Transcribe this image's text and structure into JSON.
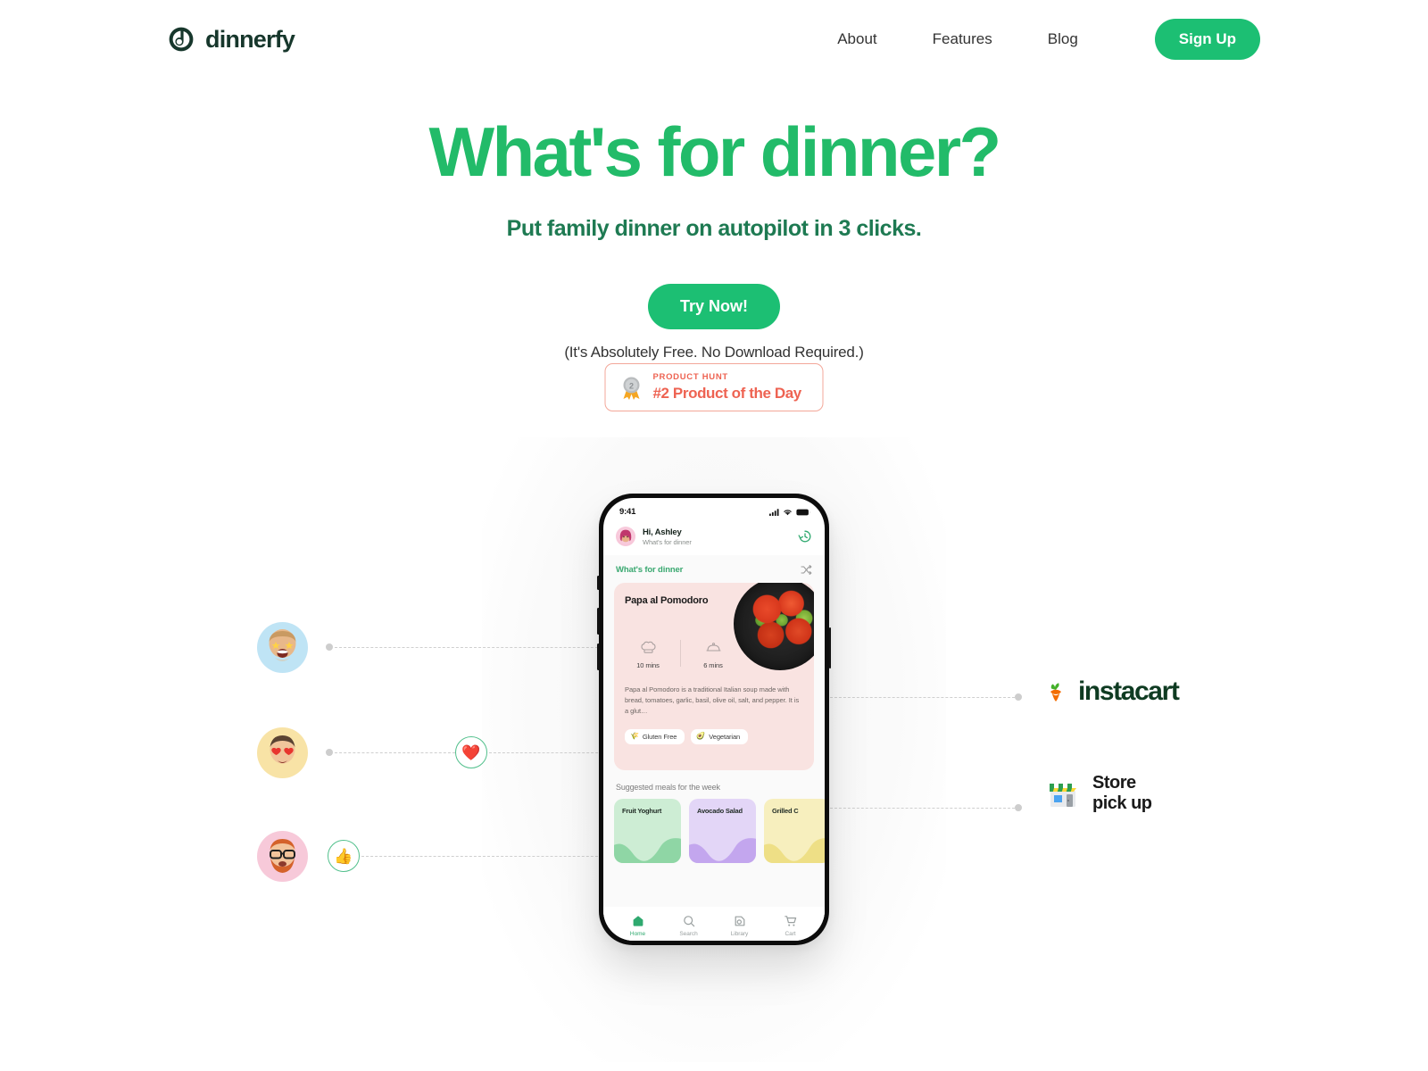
{
  "brand": {
    "name": "dinnerfy",
    "logo_icon": "dinnerfy-logo-icon",
    "accent": "#1cbf73",
    "dark": "#17372c"
  },
  "nav": {
    "links": [
      {
        "label": "About"
      },
      {
        "label": "Features"
      },
      {
        "label": "Blog"
      }
    ],
    "signup_label": "Sign Up"
  },
  "hero": {
    "headline": "What's for dinner?",
    "subhead": "Put family dinner on autopilot in 3 clicks.",
    "cta_label": "Try Now!",
    "disclaimer": "(It's Absolutely Free. No Download Required.)",
    "headline_color": "#22bb69",
    "subhead_color": "#1e7a52"
  },
  "product_hunt": {
    "kicker": "PRODUCT HUNT",
    "title": "#2 Product of the Day",
    "medal_icon": "silver-medal-icon",
    "rank": "2",
    "color": "#ee6352",
    "border_color": "#f3a799"
  },
  "phone": {
    "status": {
      "time": "9:41",
      "cellular_icon": "cellular-bars-icon",
      "wifi_icon": "wifi-icon",
      "battery_icon": "battery-icon"
    },
    "topbar": {
      "avatar_icon": "user-avatar-icon",
      "greeting": "Hi, Ashley",
      "subgreeting": "What's for dinner",
      "history_icon": "history-clock-icon"
    },
    "section": {
      "title": "What's for dinner",
      "shuffle_icon": "shuffle-icon"
    },
    "recipe": {
      "title": "Papa al Pomodoro",
      "photo_icon": "tomato-soup-photo",
      "meta": [
        {
          "icon": "chef-hat-icon",
          "label": "10 mins"
        },
        {
          "icon": "food-cloche-icon",
          "label": "6 mins"
        }
      ],
      "description": "Papa al Pomodoro is a traditional Italian soup made with bread, tomatoes, garlic, basil, olive oil, salt, and pepper. It is a glut…",
      "tags": [
        {
          "emoji": "🌾",
          "label": "Gluten Free"
        },
        {
          "emoji": "🥑",
          "label": "Vegetarian"
        }
      ]
    },
    "suggested": {
      "title": "Suggested meals for the week",
      "meals": [
        {
          "label": "Fruit Yoghurt",
          "bg": "#cdedd4",
          "wave": "#8fd6a5"
        },
        {
          "label": "Avocado Salad",
          "bg": "#e3d6f7",
          "wave": "#c3a6ee"
        },
        {
          "label": "Grilled C",
          "bg": "#f7efbe",
          "wave": "#eedf86"
        }
      ]
    },
    "tabs": [
      {
        "label": "Home",
        "icon": "home-icon",
        "active": true
      },
      {
        "label": "Search",
        "icon": "search-icon",
        "active": false
      },
      {
        "label": "Library",
        "icon": "library-icon",
        "active": false
      },
      {
        "label": "Cart",
        "icon": "cart-icon",
        "active": false
      }
    ]
  },
  "family": {
    "avatars": [
      {
        "icon": "memoji-star-eyes",
        "bg": "#bfe4f5"
      },
      {
        "icon": "memoji-heart-eyes",
        "bg": "#f8e3a6"
      },
      {
        "icon": "memoji-glasses-beard",
        "bg": "#f7c9d9"
      }
    ],
    "reactions": [
      {
        "icon": "heart-reaction-icon",
        "emoji": "❤️"
      },
      {
        "icon": "thumbs-up-reaction-icon",
        "emoji": "👍"
      }
    ]
  },
  "partners": [
    {
      "name": "instacart",
      "icon": "instacart-carrot-icon"
    },
    {
      "name_line1": "Store",
      "name_line2": "pick up",
      "icon": "storefront-icon"
    }
  ]
}
